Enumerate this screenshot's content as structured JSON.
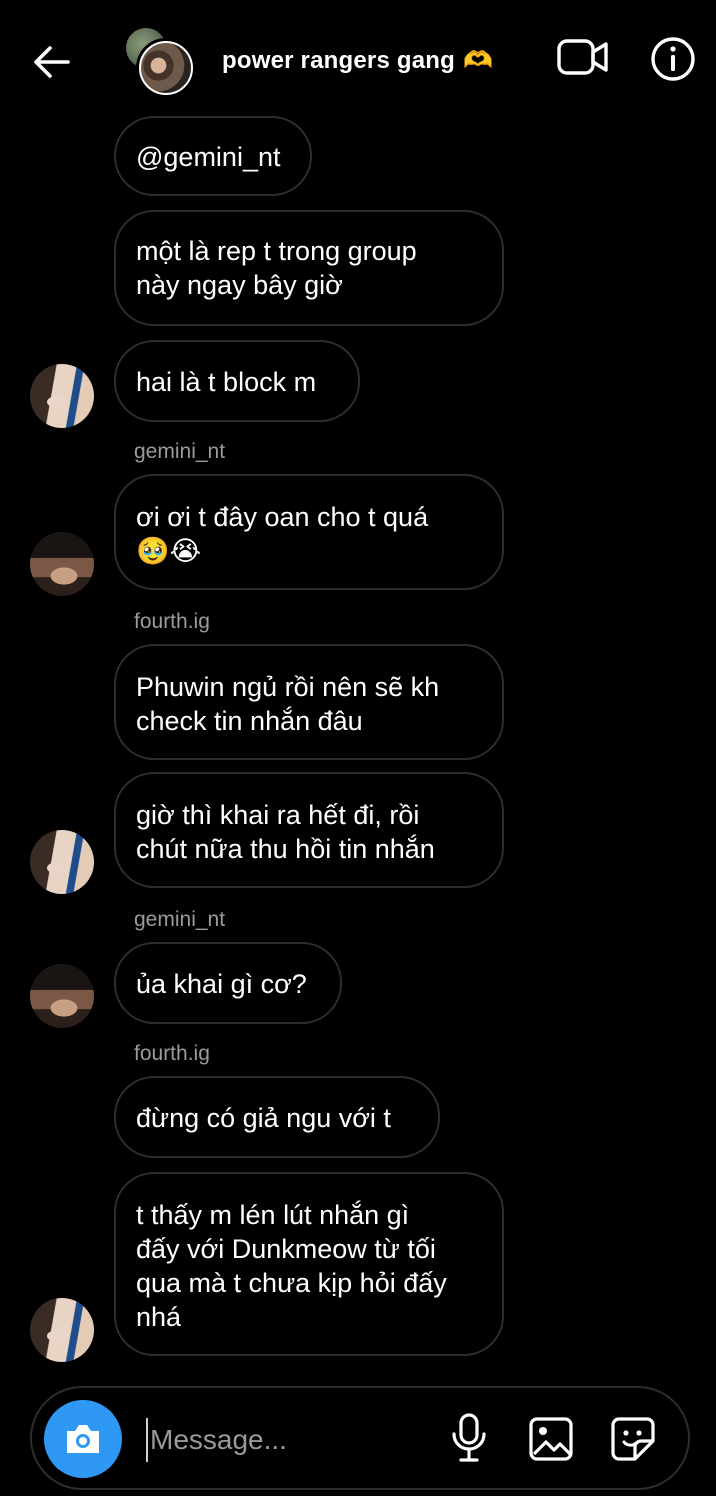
{
  "header": {
    "title": "power rangers gang",
    "title_emoji": "🫶",
    "icons": {
      "back": "arrow-left-icon",
      "video": "video-camera-icon",
      "info": "info-icon"
    }
  },
  "messages": [
    {
      "text": "@gemini_nt"
    },
    {
      "text": "một là rep t trong group\nnày ngay bây giờ"
    },
    {
      "text": "hai là t block m"
    },
    {
      "sender": "gemini_nt",
      "text": "ơi ơi t đây oan cho t quá\n🥹😭"
    },
    {
      "sender": "fourth.ig",
      "text": "Phuwin ngủ rồi nên sẽ kh\ncheck tin nhắn đâu"
    },
    {
      "text": "giờ thì khai ra hết đi, rồi\nchút nữa thu hồi tin nhắn"
    },
    {
      "sender": "gemini_nt",
      "text": "ủa khai gì cơ?"
    },
    {
      "sender": "fourth.ig",
      "text": "đừng có giả ngu với t"
    },
    {
      "text": "t thấy m lén lút nhắn gì\nđấy với Dunkmeow từ tối\nqua mà t chưa kịp hỏi đấy\nnhá"
    }
  ],
  "composer": {
    "placeholder": "Message...",
    "value": "",
    "icons": {
      "camera": "camera-icon",
      "mic": "microphone-icon",
      "gallery": "gallery-icon",
      "sticker": "sticker-icon"
    },
    "camera_color": "#2f97f4"
  }
}
